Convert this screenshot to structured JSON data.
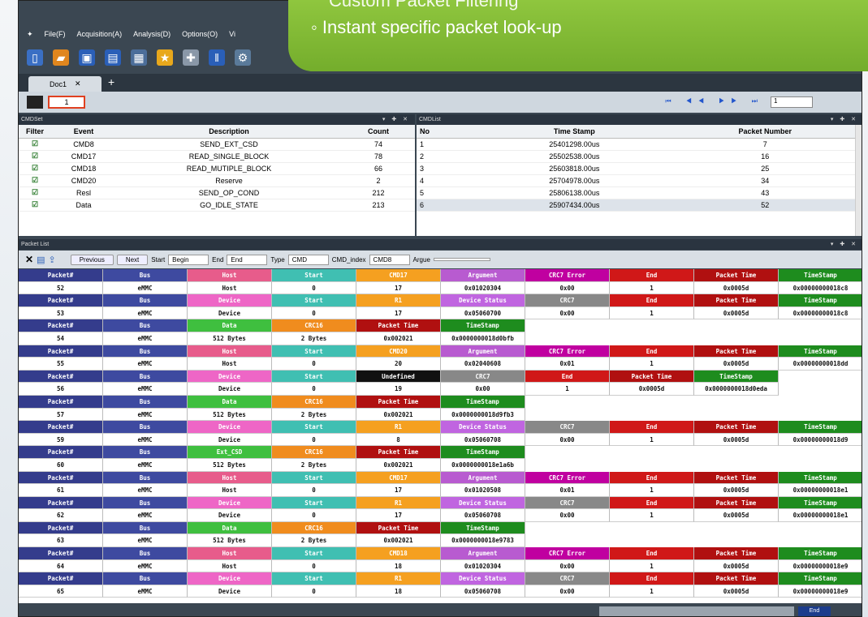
{
  "callout": {
    "line1": "Custom Packet Filtering",
    "line2": "◦ Instant specific packet look-up"
  },
  "menu": [
    "File(F)",
    "Acquisition(A)",
    "Analysis(D)",
    "Options(O)",
    "Vi"
  ],
  "tab": {
    "label": "Doc1"
  },
  "nav": {
    "page": "1",
    "goto": "1"
  },
  "cmdset": {
    "title": "CMDSet",
    "columns": [
      "Filter",
      "Event",
      "Description",
      "Count"
    ],
    "rows": [
      {
        "event": "CMD8",
        "desc": "SEND_EXT_CSD",
        "count": "74"
      },
      {
        "event": "CMD17",
        "desc": "READ_SINGLE_BLOCK",
        "count": "78"
      },
      {
        "event": "CMD18",
        "desc": "READ_MUTIPLE_BLOCK",
        "count": "66"
      },
      {
        "event": "CMD20",
        "desc": "Reserve",
        "count": "2"
      },
      {
        "event": "Resl",
        "desc": "SEND_OP_COND",
        "count": "212"
      },
      {
        "event": "Data",
        "desc": "GO_IDLE_STATE",
        "count": "213"
      }
    ]
  },
  "cmdlist": {
    "title": "CMDList",
    "columns": [
      "No",
      "Time Stamp",
      "Packet Number"
    ],
    "rows": [
      {
        "no": "1",
        "ts": "25401298.00us",
        "pn": "7"
      },
      {
        "no": "2",
        "ts": "25502538.00us",
        "pn": "16"
      },
      {
        "no": "3",
        "ts": "25603818.00us",
        "pn": "25"
      },
      {
        "no": "4",
        "ts": "25704978.00us",
        "pn": "34"
      },
      {
        "no": "5",
        "ts": "25806138.00us",
        "pn": "43"
      },
      {
        "no": "6",
        "ts": "25907434.00us",
        "pn": "52"
      }
    ]
  },
  "packetlist": {
    "title": "Packet List"
  },
  "filter": {
    "previous": "Previous",
    "next": "Next",
    "start_label": "Start",
    "start_val": "Begin",
    "end_label": "End",
    "end_val": "End",
    "type_label": "Type",
    "type_val": "CMD",
    "cmdidx_label": "CMD_index",
    "cmdidx_val": "CMD8",
    "argue_label": "Argue"
  },
  "packets": [
    {
      "h": [
        [
          "Packet#",
          "c-pk"
        ],
        [
          "Bus",
          "c-bus"
        ],
        [
          "Host",
          "c-host"
        ],
        [
          "Start",
          "c-start"
        ],
        [
          "CMD17",
          "c-cmd"
        ],
        [
          "Argument",
          "c-arg"
        ],
        [
          "CRC7 Error",
          "c-crc7e"
        ],
        [
          "End",
          "c-end"
        ],
        [
          "Packet Time",
          "c-pt"
        ],
        [
          "TimeStamp",
          "c-ts"
        ]
      ],
      "v": [
        "52",
        "eMMC",
        "Host",
        "0",
        "17",
        "0x01020304",
        "0x00",
        "1",
        "0x0005d",
        "0x00000000018c8"
      ]
    },
    {
      "h": [
        [
          "Packet#",
          "c-pk"
        ],
        [
          "Bus",
          "c-bus"
        ],
        [
          "Device",
          "c-dev"
        ],
        [
          "Start",
          "c-start"
        ],
        [
          "R1",
          "c-cmd"
        ],
        [
          "Device Status",
          "c-dstat"
        ],
        [
          "CRC7",
          "c-crc7"
        ],
        [
          "End",
          "c-end"
        ],
        [
          "Packet Time",
          "c-pt"
        ],
        [
          "TimeStamp",
          "c-ts"
        ]
      ],
      "v": [
        "53",
        "eMMC",
        "Device",
        "0",
        "17",
        "0x05060700",
        "0x00",
        "1",
        "0x0005d",
        "0x00000000018c8"
      ]
    },
    {
      "h": [
        [
          "Packet#",
          "c-pk"
        ],
        [
          "Bus",
          "c-bus"
        ],
        [
          "Data",
          "c-data"
        ],
        [
          "CRC16",
          "c-crc"
        ],
        [
          "Packet Time",
          "c-pt"
        ],
        [
          "TimeStamp",
          "c-ts"
        ]
      ],
      "v": [
        "54",
        "eMMC",
        "512 Bytes",
        "2 Bytes",
        "0x002021",
        "0x0000000018d0bfb"
      ]
    },
    {
      "h": [
        [
          "Packet#",
          "c-pk"
        ],
        [
          "Bus",
          "c-bus"
        ],
        [
          "Host",
          "c-host"
        ],
        [
          "Start",
          "c-start"
        ],
        [
          "CMD20",
          "c-cmd"
        ],
        [
          "Argument",
          "c-arg"
        ],
        [
          "CRC7 Error",
          "c-crc7e"
        ],
        [
          "End",
          "c-end"
        ],
        [
          "Packet Time",
          "c-pt"
        ],
        [
          "TimeStamp",
          "c-ts"
        ]
      ],
      "v": [
        "55",
        "eMMC",
        "Host",
        "0",
        "20",
        "0x02040608",
        "0x01",
        "1",
        "0x0005d",
        "0x00000000018dd"
      ]
    },
    {
      "h": [
        [
          "Packet#",
          "c-pk"
        ],
        [
          "Bus",
          "c-bus"
        ],
        [
          "Device",
          "c-dev"
        ],
        [
          "Start",
          "c-start"
        ],
        [
          "Undefined",
          "c-undef"
        ],
        [
          "CRC7",
          "c-crc7"
        ],
        [
          "End",
          "c-end"
        ],
        [
          "Packet Time",
          "c-pt"
        ],
        [
          "TimeStamp",
          "c-ts"
        ]
      ],
      "v": [
        "56",
        "eMMC",
        "Device",
        "0",
        "19",
        "0x00",
        "1",
        "0x0005d",
        "0x0000000018d0eda"
      ]
    },
    {
      "h": [
        [
          "Packet#",
          "c-pk"
        ],
        [
          "Bus",
          "c-bus"
        ],
        [
          "Data",
          "c-data"
        ],
        [
          "CRC16",
          "c-crc"
        ],
        [
          "Packet Time",
          "c-pt"
        ],
        [
          "TimeStamp",
          "c-ts"
        ]
      ],
      "v": [
        "57",
        "eMMC",
        "512 Bytes",
        "2 Bytes",
        "0x002021",
        "0x0000000018d9fb3"
      ]
    },
    {
      "h": [
        [
          "Packet#",
          "c-pk"
        ],
        [
          "Bus",
          "c-bus"
        ],
        [
          "Device",
          "c-dev"
        ],
        [
          "Start",
          "c-start"
        ],
        [
          "R1",
          "c-cmd"
        ],
        [
          "Device Status",
          "c-dstat"
        ],
        [
          "CRC7",
          "c-crc7"
        ],
        [
          "End",
          "c-end"
        ],
        [
          "Packet Time",
          "c-pt"
        ],
        [
          "TimeStamp",
          "c-ts"
        ]
      ],
      "v": [
        "59",
        "eMMC",
        "Device",
        "0",
        "8",
        "0x05060708",
        "0x00",
        "1",
        "0x0005d",
        "0x00000000018d9"
      ]
    },
    {
      "h": [
        [
          "Packet#",
          "c-pk"
        ],
        [
          "Bus",
          "c-bus"
        ],
        [
          "Ext_CSD",
          "c-extcsd"
        ],
        [
          "CRC16",
          "c-crc"
        ],
        [
          "Packet Time",
          "c-pt"
        ],
        [
          "TimeStamp",
          "c-ts"
        ]
      ],
      "v": [
        "60",
        "eMMC",
        "512 Bytes",
        "2 Bytes",
        "0x002021",
        "0x0000000018e1a6b"
      ]
    },
    {
      "h": [
        [
          "Packet#",
          "c-pk"
        ],
        [
          "Bus",
          "c-bus"
        ],
        [
          "Host",
          "c-host"
        ],
        [
          "Start",
          "c-start"
        ],
        [
          "CMD17",
          "c-cmd"
        ],
        [
          "Argument",
          "c-arg"
        ],
        [
          "CRC7 Error",
          "c-crc7e"
        ],
        [
          "End",
          "c-end"
        ],
        [
          "Packet Time",
          "c-pt"
        ],
        [
          "TimeStamp",
          "c-ts"
        ]
      ],
      "v": [
        "61",
        "eMMC",
        "Host",
        "0",
        "17",
        "0x01020508",
        "0x01",
        "1",
        "0x0005d",
        "0x00000000018e1"
      ]
    },
    {
      "h": [
        [
          "Packet#",
          "c-pk"
        ],
        [
          "Bus",
          "c-bus"
        ],
        [
          "Device",
          "c-dev"
        ],
        [
          "Start",
          "c-start"
        ],
        [
          "R1",
          "c-cmd"
        ],
        [
          "Device Status",
          "c-dstat"
        ],
        [
          "CRC7",
          "c-crc7"
        ],
        [
          "End",
          "c-end"
        ],
        [
          "Packet Time",
          "c-pt"
        ],
        [
          "TimeStamp",
          "c-ts"
        ]
      ],
      "v": [
        "62",
        "eMMC",
        "Device",
        "0",
        "17",
        "0x05060708",
        "0x00",
        "1",
        "0x0005d",
        "0x00000000018e1"
      ]
    },
    {
      "h": [
        [
          "Packet#",
          "c-pk"
        ],
        [
          "Bus",
          "c-bus"
        ],
        [
          "Data",
          "c-data"
        ],
        [
          "CRC16",
          "c-crc"
        ],
        [
          "Packet Time",
          "c-pt"
        ],
        [
          "TimeStamp",
          "c-ts"
        ]
      ],
      "v": [
        "63",
        "eMMC",
        "512 Bytes",
        "2 Bytes",
        "0x002021",
        "0x0000000018e9783"
      ]
    },
    {
      "h": [
        [
          "Packet#",
          "c-pk"
        ],
        [
          "Bus",
          "c-bus"
        ],
        [
          "Host",
          "c-host"
        ],
        [
          "Start",
          "c-start"
        ],
        [
          "CMD18",
          "c-cmd"
        ],
        [
          "Argument",
          "c-arg"
        ],
        [
          "CRC7 Error",
          "c-crc7e"
        ],
        [
          "End",
          "c-end"
        ],
        [
          "Packet Time",
          "c-pt"
        ],
        [
          "TimeStamp",
          "c-ts"
        ]
      ],
      "v": [
        "64",
        "eMMC",
        "Host",
        "0",
        "18",
        "0x01020304",
        "0x00",
        "1",
        "0x0005d",
        "0x00000000018e9"
      ]
    },
    {
      "h": [
        [
          "Packet#",
          "c-pk"
        ],
        [
          "Bus",
          "c-bus"
        ],
        [
          "Device",
          "c-dev"
        ],
        [
          "Start",
          "c-start"
        ],
        [
          "R1",
          "c-cmd"
        ],
        [
          "Device Status",
          "c-dstat"
        ],
        [
          "CRC7",
          "c-crc7"
        ],
        [
          "End",
          "c-end"
        ],
        [
          "Packet Time",
          "c-pt"
        ],
        [
          "TimeStamp",
          "c-ts"
        ]
      ],
      "v": [
        "65",
        "eMMC",
        "Device",
        "0",
        "18",
        "0x05060708",
        "0x00",
        "1",
        "0x0005d",
        "0x00000000018e9"
      ]
    }
  ],
  "statusbar": {
    "end": "End"
  }
}
